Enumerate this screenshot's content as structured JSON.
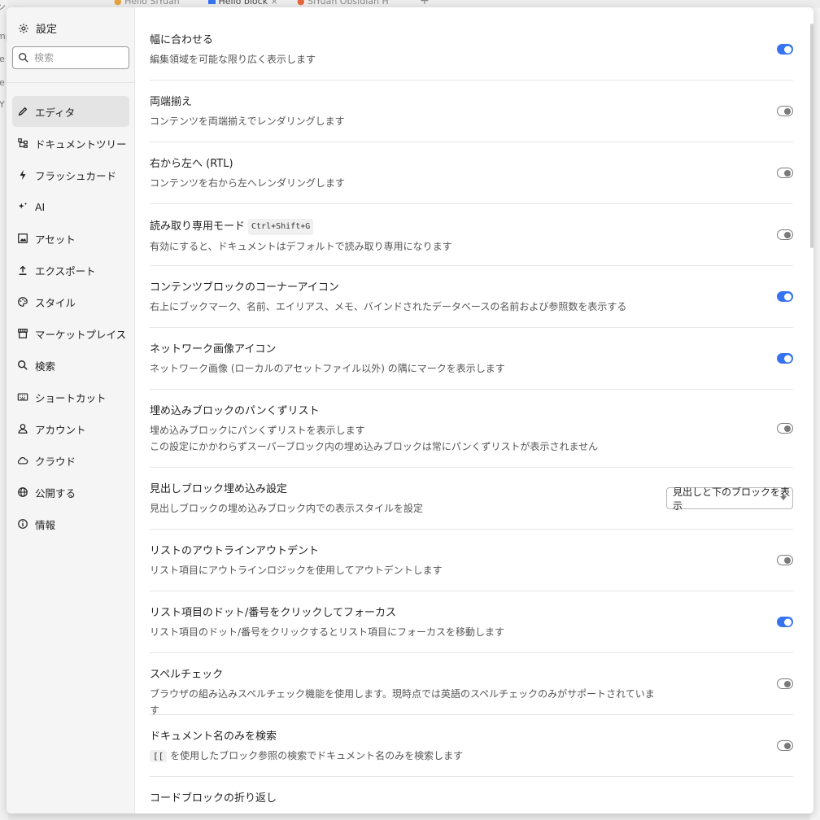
{
  "background": {
    "tabs": [
      "Hello SiYuan",
      "Hello block",
      "SiYuan Obsidian H"
    ],
    "tab_close": "×",
    "tab_add": "+",
    "left_fragments": [
      "ントツリー",
      "mp",
      "le",
      "le",
      "iY"
    ]
  },
  "sidebar": {
    "title": "設定",
    "search_placeholder": "検索",
    "items": [
      {
        "label": "エディタ",
        "icon": "pencil-icon",
        "active": true
      },
      {
        "label": "ドキュメントツリー",
        "icon": "tree-icon"
      },
      {
        "label": "フラッシュカード",
        "icon": "flash-icon"
      },
      {
        "label": "AI",
        "icon": "sparkle-icon"
      },
      {
        "label": "アセット",
        "icon": "image-icon"
      },
      {
        "label": "エクスポート",
        "icon": "upload-icon"
      },
      {
        "label": "スタイル",
        "icon": "palette-icon"
      },
      {
        "label": "マーケットプレイス",
        "icon": "store-icon"
      },
      {
        "label": "検索",
        "icon": "search-icon"
      },
      {
        "label": "ショートカット",
        "icon": "keyboard-icon"
      },
      {
        "label": "アカウント",
        "icon": "user-icon"
      },
      {
        "label": "クラウド",
        "icon": "cloud-icon"
      },
      {
        "label": "公開する",
        "icon": "globe-icon"
      },
      {
        "label": "情報",
        "icon": "info-icon"
      }
    ]
  },
  "settings": [
    {
      "title": "幅に合わせる",
      "desc": [
        "編集領域を可能な限り広く表示します"
      ],
      "control": "toggle",
      "on": true
    },
    {
      "title": "両端揃え",
      "desc": [
        "コンテンツを両端揃えでレンダリングします"
      ],
      "control": "toggle",
      "on": false
    },
    {
      "title": "右から左へ (RTL)",
      "desc": [
        "コンテンツを右から左へレンダリングします"
      ],
      "control": "toggle",
      "on": false
    },
    {
      "title": "読み取り専用モード",
      "kbd": "Ctrl+Shift+G",
      "desc": [
        "有効にすると、ドキュメントはデフォルトで読み取り専用になります"
      ],
      "control": "toggle",
      "on": false
    },
    {
      "title": "コンテンツブロックのコーナーアイコン",
      "desc": [
        "右上にブックマーク、名前、エイリアス、メモ、バインドされたデータベースの名前および参照数を表示する"
      ],
      "control": "toggle",
      "on": true
    },
    {
      "title": "ネットワーク画像アイコン",
      "desc": [
        "ネットワーク画像 (ローカルのアセットファイル以外) の隅にマークを表示します"
      ],
      "control": "toggle",
      "on": true
    },
    {
      "title": "埋め込みブロックのパンくずリスト",
      "desc": [
        "埋め込みブロックにパンくずリストを表示します",
        "この設定にかかわらずスーパーブロック内の埋め込みブロックは常にパンくずリストが表示されません"
      ],
      "control": "toggle",
      "on": false
    },
    {
      "title": "見出しブロック埋め込み設定",
      "desc": [
        "見出しブロックの埋め込みブロック内での表示スタイルを設定"
      ],
      "control": "select",
      "value": "見出しと下のブロックを表示"
    },
    {
      "title": "リストのアウトラインアウトデント",
      "desc": [
        "リスト項目にアウトラインロジックを使用してアウトデントします"
      ],
      "control": "toggle",
      "on": false
    },
    {
      "title": "リスト項目のドット/番号をクリックしてフォーカス",
      "desc": [
        "リスト項目のドット/番号をクリックするとリスト項目にフォーカスを移動します"
      ],
      "control": "toggle",
      "on": true
    },
    {
      "title": "スペルチェック",
      "desc": [
        "ブラウザの組み込みスペルチェック機能を使用します。現時点では英語のスペルチェックのみがサポートされています"
      ],
      "control": "toggle",
      "on": false
    },
    {
      "title": "ドキュメント名のみを検索",
      "code": "[[",
      "desc": [
        "を使用したブロック参照の検索でドキュメント名のみを検索します"
      ],
      "control": "toggle",
      "on": false
    },
    {
      "title": "コードブロックの折り返し",
      "desc": [],
      "control": "none"
    }
  ],
  "colors": {
    "accent": "#3573f0",
    "sidebar_bg": "#f5f5f5",
    "active_bg": "#e4e4e4"
  }
}
